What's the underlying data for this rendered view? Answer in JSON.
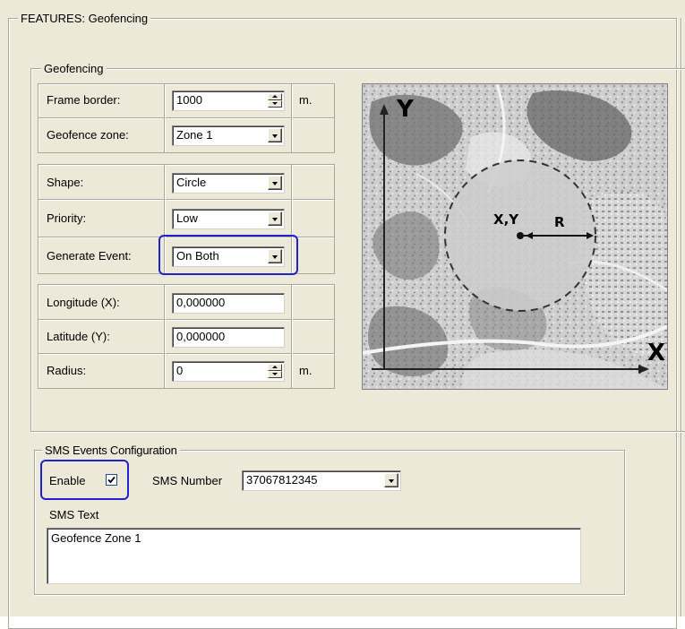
{
  "features_group": {
    "title": "FEATURES: Geofencing"
  },
  "geofencing": {
    "title": "Geofencing",
    "frame_border": {
      "label": "Frame border:",
      "value": "1000",
      "unit": "m."
    },
    "geofence_zone": {
      "label": "Geofence zone:",
      "value": "Zone 1"
    },
    "shape": {
      "label": "Shape:",
      "value": "Circle"
    },
    "priority": {
      "label": "Priority:",
      "value": "Low"
    },
    "generate_event": {
      "label": "Generate Event:",
      "value": "On Both"
    },
    "longitude": {
      "label": "Longitude (X):",
      "value": "0,000000"
    },
    "latitude": {
      "label": "Latitude (Y):",
      "value": "0,000000"
    },
    "radius": {
      "label": "Radius:",
      "value": "0",
      "unit": "m."
    }
  },
  "diagram": {
    "y_axis": "Y",
    "x_axis": "X",
    "center": "X,Y",
    "radius": "R"
  },
  "sms": {
    "title": "SMS Events Configuration",
    "enable_label": "Enable",
    "enable_checked": true,
    "number_label": "SMS Number",
    "number_value": "37067812345",
    "text_label": "SMS Text",
    "text_value": "Geofence Zone 1"
  },
  "colors": {
    "panel": "#ece9d8",
    "highlight": "#1f23c9"
  }
}
